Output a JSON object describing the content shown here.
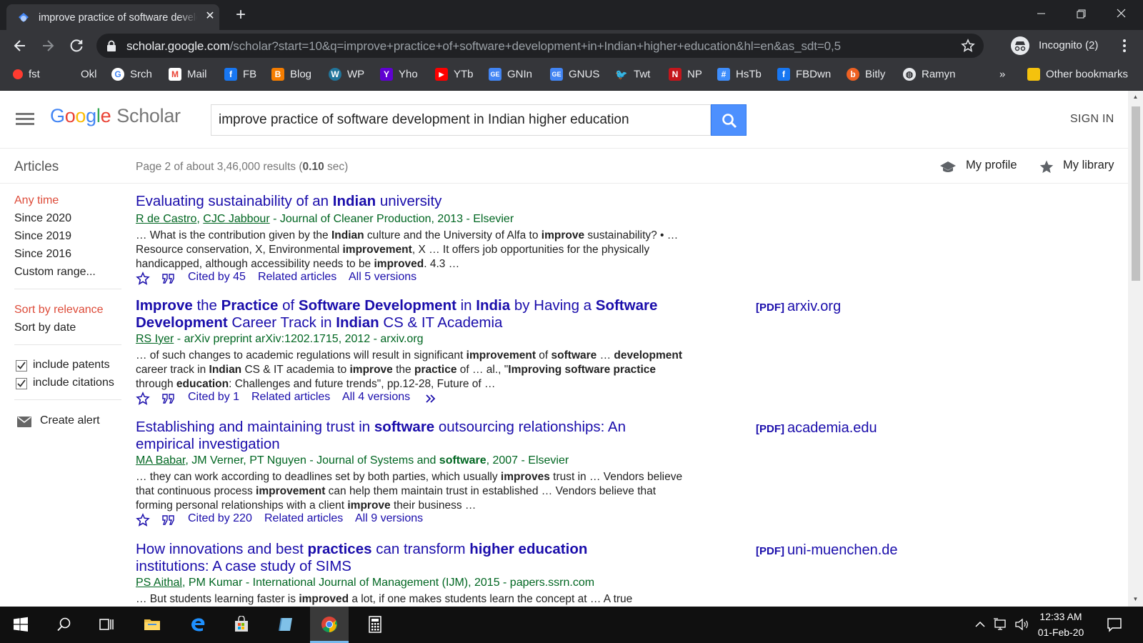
{
  "browser": {
    "tab_title": "improve practice of software development in Indian higher education - Google Scholar",
    "url_host": "scholar.google.com",
    "url_path": "/scholar?start=10&q=improve+practice+of+software+development+in+Indian+higher+education&hl=en&as_sdt=0,5",
    "incognito_label": "Incognito (2)",
    "bookmarks": [
      {
        "label": "fst",
        "icon": "red-dot-icon",
        "color": "#ff3b30"
      },
      {
        "label": "Okl",
        "icon": "none-icon",
        "color": ""
      },
      {
        "label": "Srch",
        "icon": "google-g-icon",
        "color": "#ffffff"
      },
      {
        "label": "Mail",
        "icon": "gmail-icon",
        "color": "#ea4335"
      },
      {
        "label": "FB",
        "icon": "facebook-icon",
        "color": "#1877f2"
      },
      {
        "label": "Blog",
        "icon": "blogger-icon",
        "color": "#f57d00"
      },
      {
        "label": "WP",
        "icon": "wordpress-icon",
        "color": "#21759b"
      },
      {
        "label": "Yho",
        "icon": "yahoo-icon",
        "color": "#6001d2"
      },
      {
        "label": "YTb",
        "icon": "youtube-icon",
        "color": "#ff0000"
      },
      {
        "label": "GNIn",
        "icon": "google-news-icon",
        "color": "#4285f4"
      },
      {
        "label": "GNUS",
        "icon": "google-news-icon",
        "color": "#4285f4"
      },
      {
        "label": "Twt",
        "icon": "twitter-icon",
        "color": "#1da1f2"
      },
      {
        "label": "NP",
        "icon": "np-icon",
        "color": "#c4161c"
      },
      {
        "label": "HsTb",
        "icon": "hashtag-icon",
        "color": "#3f8efc"
      },
      {
        "label": "FBDwn",
        "icon": "facebook-icon",
        "color": "#1877f2"
      },
      {
        "label": "Bitly",
        "icon": "bitly-icon",
        "color": "#ee6123"
      },
      {
        "label": "Ramyn",
        "icon": "globe-icon",
        "color": "#e8eaed"
      }
    ],
    "bookmarks_overflow": "»",
    "other_bookmarks": "Other bookmarks"
  },
  "scholar": {
    "logo_google": [
      "G",
      "o",
      "o",
      "g",
      "l",
      "e"
    ],
    "logo_scholar": "Scholar",
    "search_query": "improve practice of software development in Indian higher education",
    "sign_in": "SIGN IN",
    "articles_label": "Articles",
    "result_stats_prefix": "Page 2 of about 3,46,000 results (",
    "result_stats_time": "0.10",
    "result_stats_suffix": " sec)",
    "my_profile": "My profile",
    "my_library": "My library",
    "sidebar": {
      "time_filters": [
        "Any time",
        "Since 2020",
        "Since 2019",
        "Since 2016",
        "Custom range..."
      ],
      "sort_options": [
        "Sort by relevance",
        "Sort by date"
      ],
      "include_patents": "include patents",
      "include_citations": "include citations",
      "create_alert": "Create alert"
    },
    "results": [
      {
        "title_html": "Evaluating sustainability of an <b>Indian</b> university",
        "meta_html": "<u>R de Castro</u>, <u>CJC Jabbour</u> - Journal of Cleaner Production, 2013 - Elsevier",
        "snippet_html": "… What is the contribution given by the <b>Indian</b> culture and the University of Alfa to <b>improve</b> sustainability? • … Resource conservation, X, Environmental <b>improvement</b>, X … It offers job opportunities for the physically handicapped, although accessibility needs to be <b>improved</b>. 4.3 …",
        "cited_by": "Cited by 45",
        "related": "Related articles",
        "versions": "All 5 versions",
        "side_pdf": "",
        "side_source": ""
      },
      {
        "title_html": "<b>Improve</b> the <b>Practice</b> of <b>Software Development</b> in <b>India</b> by Having a <b>Software Development</b> Career Track in <b>Indian</b> CS &amp; IT Academia",
        "meta_html": "<u>RS Iyer</u> - arXiv preprint arXiv:1202.1715, 2012 - arxiv.org",
        "snippet_html": "… of such changes to academic regulations will result in significant <b>improvement</b> of <b>software</b> … <b>development</b> career track in <b>Indian</b> CS &amp; IT academia to <b>improve</b> the <b>practice</b> of … al., \"<b>Improving software practice</b> through <b>education</b>: Challenges and future trends\", pp.12-28, Future of …",
        "cited_by": "Cited by 1",
        "related": "Related articles",
        "versions": "All 4 versions",
        "side_pdf": "[PDF]",
        "side_source": "arxiv.org"
      },
      {
        "title_html": "Establishing and maintaining trust in <b>software</b> outsourcing relationships: An empirical investigation",
        "meta_html": "<u>MA Babar</u>, JM Verner, PT Nguyen - Journal of Systems and <b>software</b>, 2007 - Elsevier",
        "snippet_html": "… they can work according to deadlines set by both parties, which usually <b>improves</b> trust in … Vendors believe that continuous process <b>improvement</b> can help them maintain trust in established … Vendors believe that forming personal relationships with a client <b>improve</b> their business …",
        "cited_by": "Cited by 220",
        "related": "Related articles",
        "versions": "All 9 versions",
        "side_pdf": "[PDF]",
        "side_source": "academia.edu"
      },
      {
        "title_html": "How innovations and best <b>practices</b> can transform <b>higher education</b> institutions: A case study of SIMS",
        "meta_html": "<u>PS Aithal</u>, PM Kumar - International Journal of Management (IJM), 2015 - papers.ssrn.com",
        "snippet_html": "… But students learning faster is <b>improved</b> a lot, if one makes students learn the concept at … A true",
        "cited_by": "",
        "related": "",
        "versions": "",
        "side_pdf": "[PDF]",
        "side_source": "uni-muenchen.de"
      }
    ]
  },
  "taskbar": {
    "time": "12:33 AM",
    "date": "01-Feb-20"
  }
}
